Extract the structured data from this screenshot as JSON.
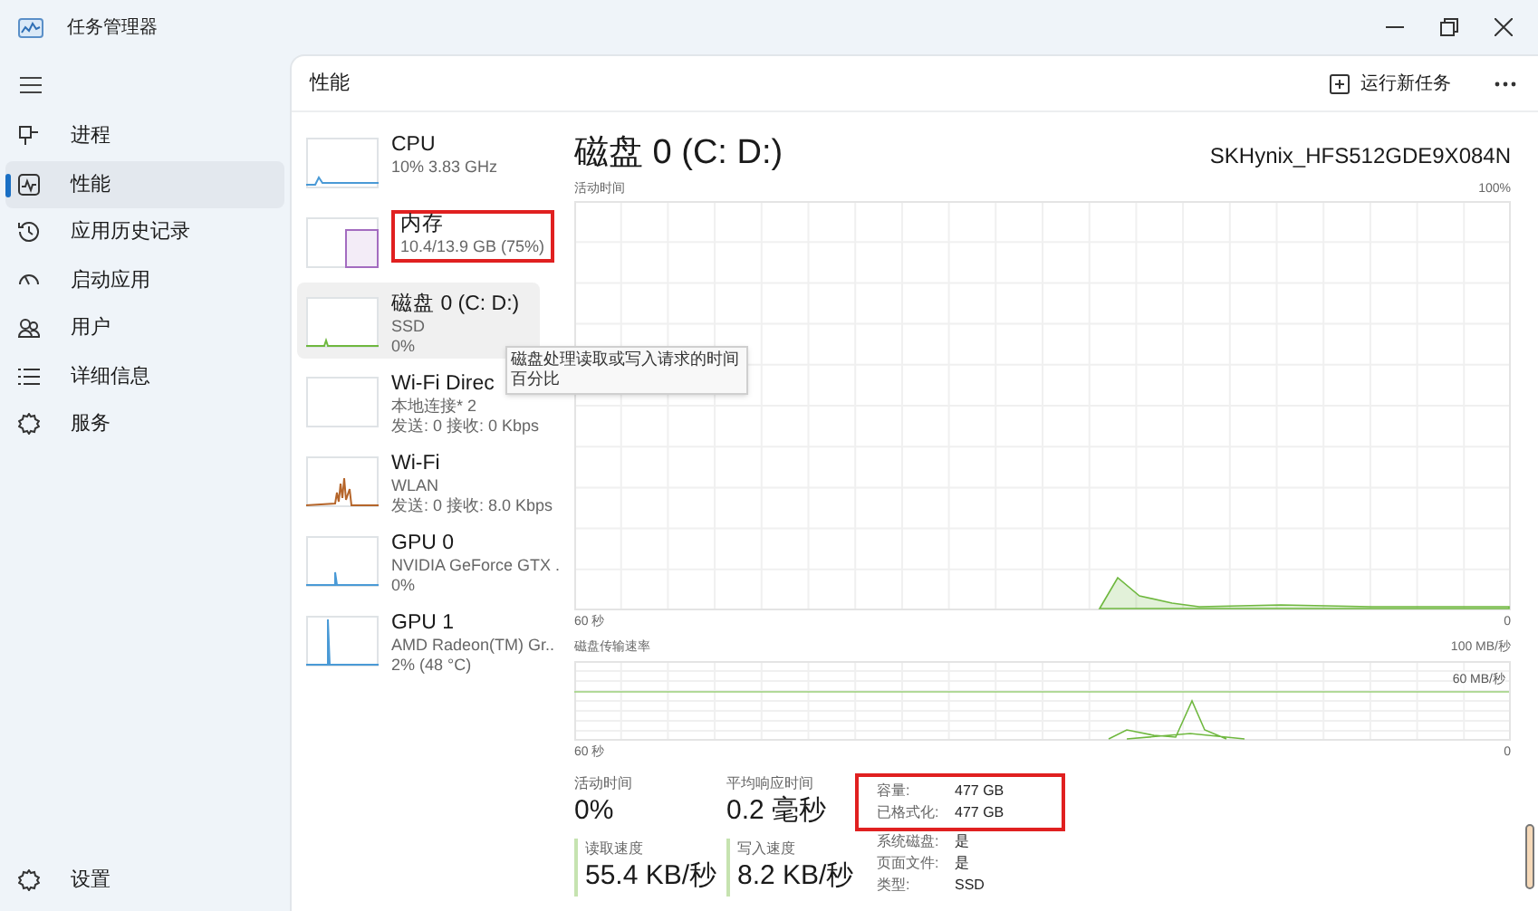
{
  "window": {
    "title": "任务管理器"
  },
  "sidebar": {
    "items": [
      {
        "label": "进程",
        "selected": false
      },
      {
        "label": "性能",
        "selected": true
      },
      {
        "label": "应用历史记录",
        "selected": false
      },
      {
        "label": "启动应用",
        "selected": false
      },
      {
        "label": "用户",
        "selected": false
      },
      {
        "label": "详细信息",
        "selected": false
      },
      {
        "label": "服务",
        "selected": false
      }
    ],
    "settings": {
      "label": "设置"
    }
  },
  "header": {
    "title": "性能",
    "run_task_button": "运行新任务"
  },
  "devices": [
    {
      "name": "CPU",
      "lines": [
        "10%  3.83 GHz"
      ],
      "color": "#4a9ad6",
      "selected": false,
      "highlighted": false
    },
    {
      "name": "内存",
      "lines": [
        "10.4/13.9 GB (75%)"
      ],
      "color": "#a36cc0",
      "selected": false,
      "highlighted": true
    },
    {
      "name": "磁盘 0 (C: D:)",
      "lines": [
        "SSD",
        "0%"
      ],
      "color": "#6fb83f",
      "selected": true,
      "highlighted": false
    },
    {
      "name": "Wi-Fi Direc",
      "lines": [
        "本地连接* 2",
        "发送: 0 接收: 0 Kbps"
      ],
      "selected": false,
      "highlighted": false
    },
    {
      "name": "Wi-Fi",
      "lines": [
        "WLAN",
        "发送: 0 接收: 8.0 Kbps"
      ],
      "color": "#b5652a",
      "selected": false,
      "highlighted": false
    },
    {
      "name": "GPU 0",
      "lines": [
        "NVIDIA GeForce GTX .",
        "0%"
      ],
      "color": "#4a9ad6",
      "selected": false,
      "highlighted": false
    },
    {
      "name": "GPU 1",
      "lines": [
        "AMD Radeon(TM) Gr..",
        "2% (48 °C)"
      ],
      "color": "#4a9ad6",
      "selected": false,
      "highlighted": false
    }
  ],
  "tooltip": "磁盘处理读取或写入请求的时间百分比",
  "detail": {
    "title": "磁盘 0 (C: D:)",
    "model": "SKHynix_HFS512GDE9X084N",
    "activity_graph": {
      "label": "活动时间",
      "max": "100%",
      "time": "60 秒",
      "min": "0"
    },
    "transfer_graph": {
      "label": "磁盘传输速率",
      "max": "100 MB/秒",
      "mid": "60 MB/秒",
      "time": "60 秒",
      "min": "0"
    },
    "stats": [
      {
        "label": "活动时间",
        "value": "0%",
        "kind": "plain"
      },
      {
        "label": "平均响应时间",
        "value": "0.2 毫秒",
        "kind": "plain"
      },
      {
        "label": "读取速度",
        "value": "55.4 KB/秒",
        "kind": "accent"
      },
      {
        "label": "写入速度",
        "value": "8.2 KB/秒",
        "kind": "accent"
      }
    ],
    "properties": [
      {
        "label": "容量:",
        "value": "477 GB",
        "highlighted": true
      },
      {
        "label": "已格式化:",
        "value": "477 GB",
        "highlighted": true
      },
      {
        "label": "系统磁盘:",
        "value": "是",
        "highlighted": false
      },
      {
        "label": "页面文件:",
        "value": "是",
        "highlighted": false
      },
      {
        "label": "类型:",
        "value": "SSD",
        "highlighted": false
      }
    ]
  }
}
